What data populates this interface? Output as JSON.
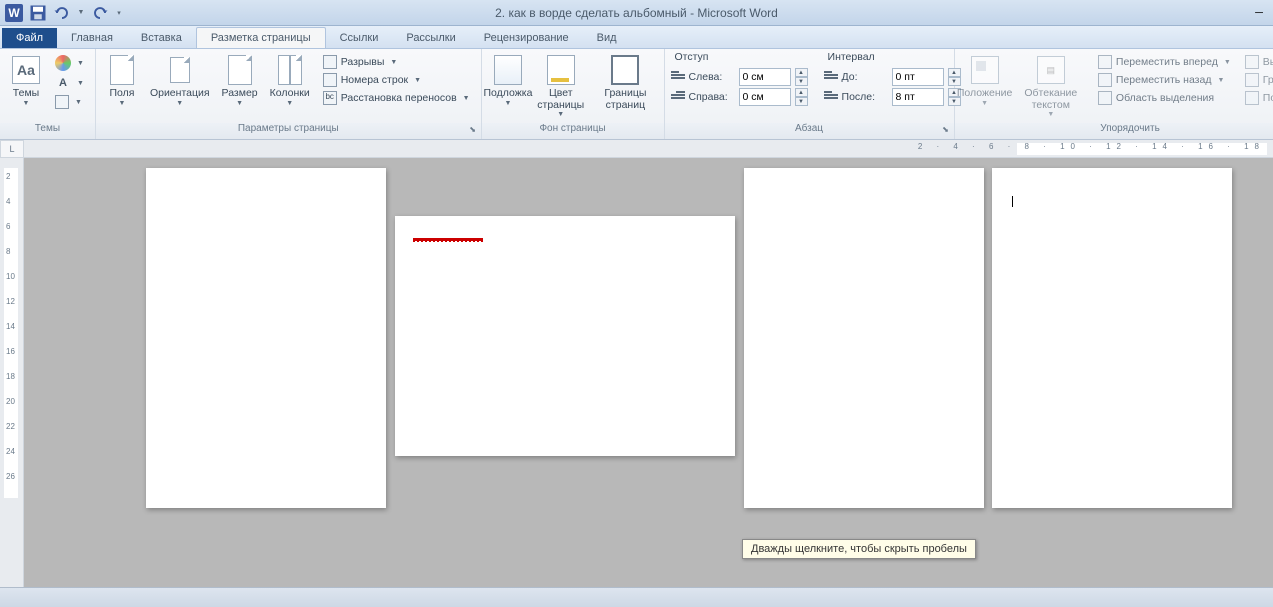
{
  "title": "2. как в ворде сделать альбомный - Microsoft Word",
  "qat": {
    "save": "save-icon",
    "undo": "undo-icon",
    "redo": "redo-icon"
  },
  "tabs": {
    "file": "Файл",
    "items": [
      "Главная",
      "Вставка",
      "Разметка страницы",
      "Ссылки",
      "Рассылки",
      "Рецензирование",
      "Вид"
    ],
    "active": "Разметка страницы"
  },
  "ribbon": {
    "themes": {
      "label": "Темы",
      "themes_btn": "Темы",
      "colors": "",
      "fonts": "",
      "effects": ""
    },
    "page_setup": {
      "label": "Параметры страницы",
      "margins": "Поля",
      "orientation": "Ориентация",
      "size": "Размер",
      "columns": "Колонки",
      "breaks": "Разрывы",
      "line_numbers": "Номера строк",
      "hyphenation": "Расстановка переносов"
    },
    "page_bg": {
      "label": "Фон страницы",
      "watermark": "Подложка",
      "page_color": "Цвет страницы",
      "borders": "Границы страниц"
    },
    "paragraph": {
      "label": "Абзац",
      "indent_title": "Отступ",
      "spacing_title": "Интервал",
      "left": "Слева:",
      "right": "Справа:",
      "before": "До:",
      "after": "После:",
      "left_val": "0 см",
      "right_val": "0 см",
      "before_val": "0 пт",
      "after_val": "8 пт"
    },
    "arrange": {
      "label": "Упорядочить",
      "position": "Положение",
      "wrap": "Обтекание текстом",
      "bring_fwd": "Переместить вперед",
      "send_back": "Переместить назад",
      "selection": "Область выделения",
      "align": "Выров",
      "group": "Групп",
      "rotate": "Повер"
    }
  },
  "ruler": {
    "tab_char": "L",
    "h_numbers": "2 · 4 · 6 · 8 · 10 · 12 · 14 · 16 · 18",
    "v_numbers": [
      "2",
      "4",
      "6",
      "8",
      "10",
      "12",
      "14",
      "16",
      "18",
      "20",
      "22",
      "24",
      "26"
    ]
  },
  "tooltip": "Дважды щелкните, чтобы скрыть пробелы"
}
